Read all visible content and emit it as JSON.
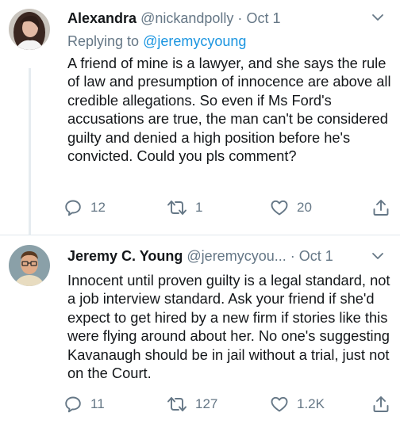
{
  "tweets": [
    {
      "name": "Alexandra",
      "handle": "@nickandpolly",
      "separator": "·",
      "date": "Oct 1",
      "replying_prefix": "Replying to",
      "replying_to": "@jeremycyoung",
      "text": "A friend of mine is a lawyer, and she says the rule of law and presumption of innocence are above all credible allegations. So even if Ms Ford's accusations are true, the man can't be considered guilty and denied a high position before he's convicted. Could you pls comment?",
      "replies": "12",
      "retweets": "1",
      "likes": "20"
    },
    {
      "name": "Jeremy C. Young",
      "handle": "@jeremycyou...",
      "separator": "·",
      "date": "Oct 1",
      "text": "Innocent until proven guilty is a legal standard, not a job interview standard. Ask your friend if she'd expect to get hired by a new firm if stories like this were flying around about her. No one's suggesting Kavanaugh should be in jail without a trial, just not on the Court.",
      "replies": "11",
      "retweets": "127",
      "likes": "1.2K"
    }
  ],
  "icons": {
    "reply": "reply-icon",
    "retweet": "retweet-icon",
    "like": "heart-icon",
    "share": "share-icon",
    "menu": "chevron-down-icon"
  },
  "colors": {
    "text": "#14171a",
    "muted": "#657786",
    "link": "#1b95e0",
    "divider": "#e1e8ed"
  }
}
